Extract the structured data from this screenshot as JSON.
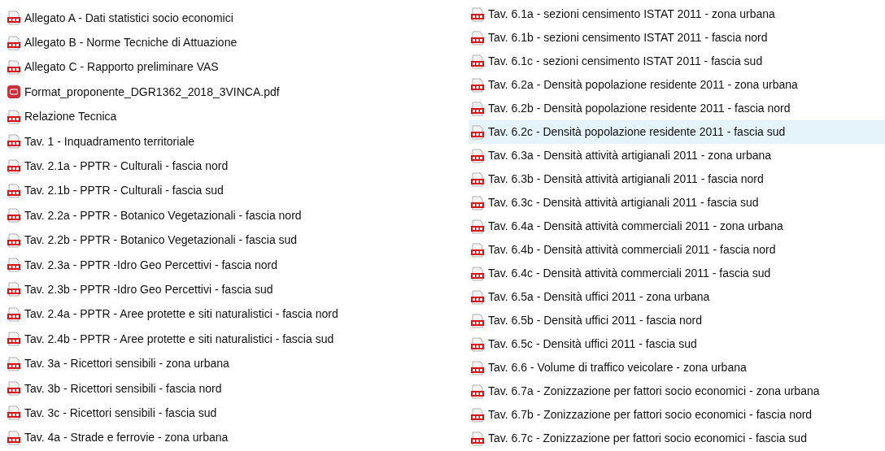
{
  "columns": [
    {
      "files": [
        {
          "name": "Allegato A - Dati statistici socio economici",
          "kind": "pdf",
          "selected": false
        },
        {
          "name": "Allegato B - Norme Tecniche di Attuazione",
          "kind": "pdf",
          "selected": false
        },
        {
          "name": "Allegato C - Rapporto preliminare VAS",
          "kind": "pdf",
          "selected": false
        },
        {
          "name": "Format_proponente_DGR1362_2018_3VINCA.pdf",
          "kind": "app",
          "selected": false
        },
        {
          "name": "Relazione Tecnica",
          "kind": "pdf",
          "selected": false
        },
        {
          "name": "Tav. 1 - Inquadramento territoriale",
          "kind": "pdf",
          "selected": false
        },
        {
          "name": "Tav. 2.1a - PPTR - Culturali - fascia nord",
          "kind": "pdf",
          "selected": false
        },
        {
          "name": "Tav. 2.1b - PPTR - Culturali - fascia sud",
          "kind": "pdf",
          "selected": false
        },
        {
          "name": "Tav. 2.2a - PPTR - Botanico Vegetazionali - fascia nord",
          "kind": "pdf",
          "selected": false
        },
        {
          "name": "Tav. 2.2b - PPTR - Botanico Vegetazionali - fascia sud",
          "kind": "pdf",
          "selected": false
        },
        {
          "name": "Tav. 2.3a - PPTR -Idro Geo Percettivi - fascia nord",
          "kind": "pdf",
          "selected": false
        },
        {
          "name": "Tav. 2.3b - PPTR -Idro Geo Percettivi - fascia sud",
          "kind": "pdf",
          "selected": false
        },
        {
          "name": "Tav. 2.4a - PPTR - Aree protette e siti naturalistici - fascia nord",
          "kind": "pdf",
          "selected": false
        },
        {
          "name": "Tav. 2.4b - PPTR - Aree protette e siti naturalistici - fascia sud",
          "kind": "pdf",
          "selected": false
        },
        {
          "name": "Tav. 3a - Ricettori sensibili - zona urbana",
          "kind": "pdf",
          "selected": false
        },
        {
          "name": "Tav. 3b - Ricettori sensibili - fascia nord",
          "kind": "pdf",
          "selected": false
        },
        {
          "name": "Tav. 3c - Ricettori sensibili - fascia sud",
          "kind": "pdf",
          "selected": false
        },
        {
          "name": "Tav. 4a - Strade e ferrovie - zona urbana",
          "kind": "pdf",
          "selected": false
        }
      ]
    },
    {
      "files": [
        {
          "name": "Tav. 6.1a - sezioni censimento ISTAT 2011 - zona urbana",
          "kind": "pdf",
          "selected": false
        },
        {
          "name": "Tav. 6.1b - sezioni censimento ISTAT 2011 - fascia nord",
          "kind": "pdf",
          "selected": false
        },
        {
          "name": "Tav. 6.1c - sezioni censimento ISTAT 2011 - fascia sud",
          "kind": "pdf",
          "selected": false
        },
        {
          "name": "Tav. 6.2a - Densità popolazione residente 2011 - zona urbana",
          "kind": "pdf",
          "selected": false
        },
        {
          "name": "Tav. 6.2b - Densità popolazione residente 2011 - fascia nord",
          "kind": "pdf",
          "selected": false
        },
        {
          "name": "Tav. 6.2c - Densità popolazione residente 2011 - fascia sud",
          "kind": "pdf",
          "selected": true
        },
        {
          "name": "Tav. 6.3a - Densità attività artigianali 2011 - zona urbana",
          "kind": "pdf",
          "selected": false
        },
        {
          "name": "Tav. 6.3b - Densità attività artigianali 2011 - fascia nord",
          "kind": "pdf",
          "selected": false
        },
        {
          "name": "Tav. 6.3c - Densità attività artigianali 2011 - fascia sud",
          "kind": "pdf",
          "selected": false
        },
        {
          "name": "Tav. 6.4a - Densità attività commerciali 2011 - zona urbana",
          "kind": "pdf",
          "selected": false
        },
        {
          "name": "Tav. 6.4b - Densità attività commerciali 2011 - fascia nord",
          "kind": "pdf",
          "selected": false
        },
        {
          "name": "Tav. 6.4c - Densità attività commerciali 2011 - fascia sud",
          "kind": "pdf",
          "selected": false
        },
        {
          "name": "Tav. 6.5a - Densità uffici 2011 - zona urbana",
          "kind": "pdf",
          "selected": false
        },
        {
          "name": "Tav. 6.5b - Densità uffici 2011 - fascia nord",
          "kind": "pdf",
          "selected": false
        },
        {
          "name": "Tav. 6.5c - Densità uffici 2011 - fascia sud",
          "kind": "pdf",
          "selected": false
        },
        {
          "name": "Tav. 6.6 - Volume di traffico veicolare - zona urbana",
          "kind": "pdf",
          "selected": false
        },
        {
          "name": "Tav. 6.7a - Zonizzazione per fattori socio economici - zona urbana",
          "kind": "pdf",
          "selected": false
        },
        {
          "name": "Tav. 6.7b - Zonizzazione per fattori socio economici - fascia nord",
          "kind": "pdf",
          "selected": false
        },
        {
          "name": "Tav. 6.7c - Zonizzazione per fattori socio economici - fascia sud",
          "kind": "pdf",
          "selected": false
        }
      ]
    }
  ]
}
